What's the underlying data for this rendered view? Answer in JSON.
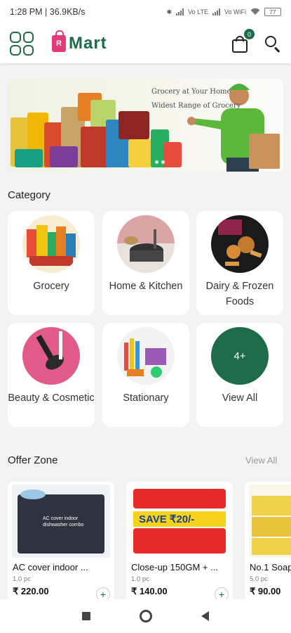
{
  "status_bar": {
    "time_speed": "1:28 PM | 36.9KB/s",
    "net1": "Vo LTE",
    "net2": "Vo WiFi",
    "battery": "77"
  },
  "app_bar": {
    "logo_letter": "R",
    "logo_text": "Mart",
    "cart_count": "0",
    "brand_color": "#1e6b4a",
    "accent_color": "#e33b78"
  },
  "banner": {
    "line1": "Grocery at Your Home",
    "line2": "Widest Range of Grocery"
  },
  "category": {
    "title": "Category",
    "items": [
      {
        "label": "Grocery"
      },
      {
        "label": "Home & Kitchen"
      },
      {
        "label": "Dairy & Frozen Foods"
      },
      {
        "label": "Beauty & Cosmetic"
      },
      {
        "label": "Stationary"
      },
      {
        "label": "View All",
        "circle_text": "4+"
      }
    ]
  },
  "offer_zone": {
    "title": "Offer Zone",
    "view_all": "View All",
    "products": [
      {
        "name": "AC cover indoor ...",
        "qty": "1.0 pc",
        "price": "₹ 220.00",
        "image_text": "AC cover indoor dishwasher combo"
      },
      {
        "name": "Close-up 150GM + ...",
        "qty": "1.0 pc",
        "price": "₹ 140.00",
        "image_text": "SAVE ₹20/-"
      },
      {
        "name": "No.1 Soap",
        "qty": "5.0 pc",
        "price": "₹ 90.00",
        "image_text": ""
      }
    ]
  },
  "nav_bar": {
    "icons": [
      "recents-icon",
      "home-icon",
      "back-icon"
    ]
  }
}
